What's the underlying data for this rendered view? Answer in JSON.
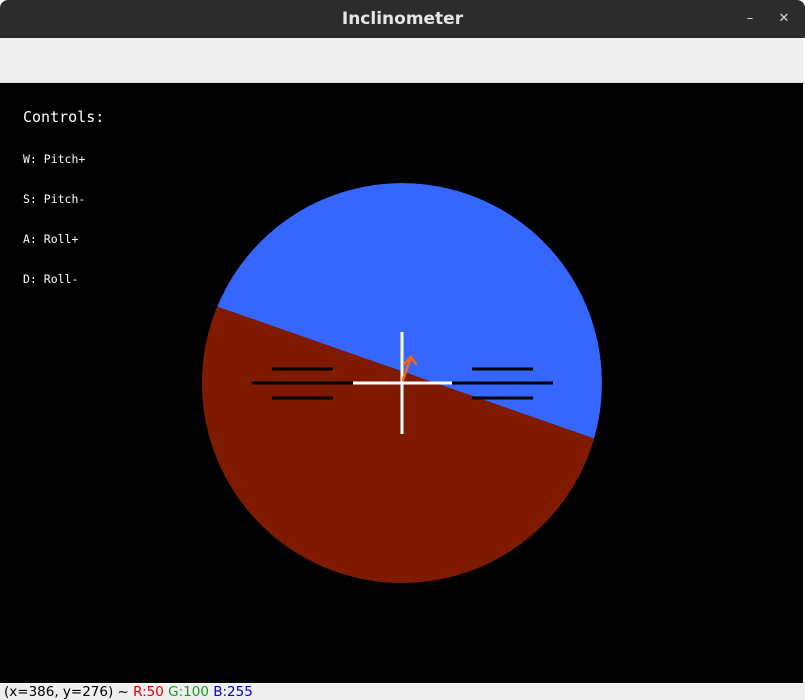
{
  "window": {
    "title": "Inclinometer",
    "minimize_label": "–",
    "close_label": "✕"
  },
  "controls": {
    "title": "Controls:",
    "items": [
      "W: Pitch+",
      "S: Pitch-",
      "A: Roll+",
      "D: Roll-"
    ]
  },
  "colors": {
    "sky": "#3566ff",
    "ground": "#7f1a00",
    "marker": "#ffffff",
    "ticks": "#000000",
    "indicator": "#ff6400"
  },
  "status": {
    "position": "(x=386, y=276) ~",
    "r": "R:50",
    "g": "G:100",
    "b": "B:255"
  }
}
